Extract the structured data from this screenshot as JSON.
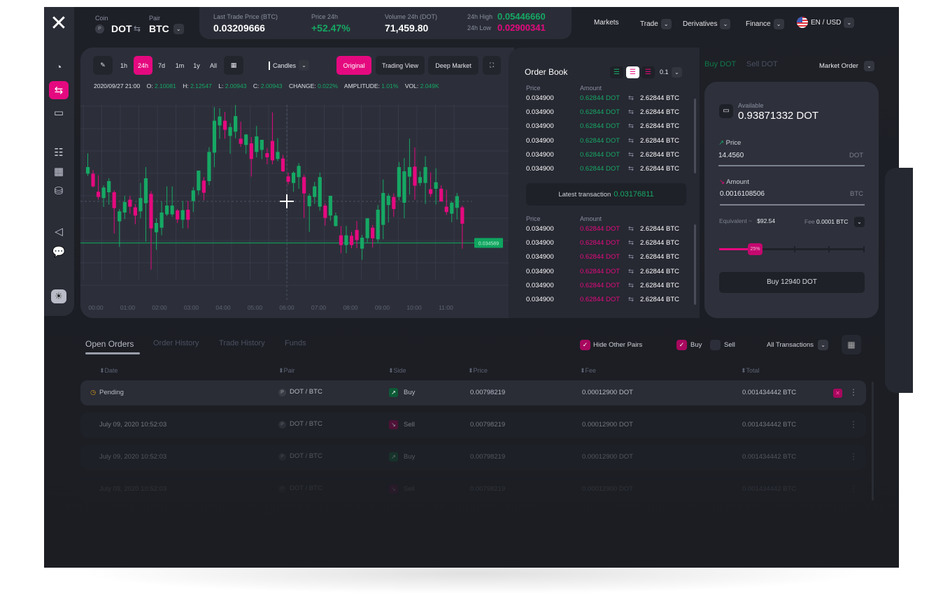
{
  "colors": {
    "accent": "#e5097f",
    "up": "#16a864",
    "down": "#e5097f",
    "background": "#1e2027",
    "panel": "#2c2f3a"
  },
  "sidebar": {
    "items": [
      {
        "icon": "pie-chart-icon"
      },
      {
        "icon": "exchange-icon",
        "active": true
      },
      {
        "icon": "wallet-icon"
      },
      {
        "icon": "list-icon"
      },
      {
        "icon": "calendar-icon"
      },
      {
        "icon": "coins-icon"
      },
      {
        "icon": "megaphone-icon"
      },
      {
        "icon": "chat-icon"
      },
      {
        "icon": "sun-icon"
      }
    ]
  },
  "header": {
    "coin_label": "Coin",
    "coin": "DOT",
    "pair_label": "Pair",
    "pair": "BTC",
    "stats": {
      "last_trade_label": "Last Trade Price (BTC)",
      "last_trade": "0.03209666",
      "price24_label": "Price 24h",
      "price24": "+52.47%",
      "volume_label": "Volume 24h (DOT)",
      "volume": "71,459.80",
      "high_label": "24h High",
      "high": "0.05446660",
      "low_label": "24h Low",
      "low": "0.02900341"
    },
    "nav": {
      "markets": "Markets",
      "trade": "Trade",
      "derivatives": "Derivatives",
      "finance": "Finance",
      "lang": "EN / USD"
    }
  },
  "chart_toolbar": {
    "periods": [
      "1h",
      "24h",
      "7d",
      "1m",
      "1y",
      "All"
    ],
    "active_period": "24h",
    "type": "Candles",
    "views": [
      "Original",
      "Trading View",
      "Deep Market"
    ],
    "active_view": "Original"
  },
  "ohlc": {
    "date": "2020/09/27 21:00",
    "o_label": "O:",
    "o": "2.10081",
    "h_label": "H:",
    "h": "2.12547",
    "l_label": "L:",
    "l": "2.00943",
    "c_label": "C:",
    "c": "2.00943",
    "change_label": "CHANGE:",
    "change": "0.022%",
    "amp_label": "AMPLITUDE:",
    "amp": "1.01%",
    "vol_label": "VOL:",
    "vol": "2.049K"
  },
  "chart_data": {
    "type": "candlestick",
    "x_ticks": [
      "00:00",
      "01:00",
      "02:00",
      "03:00",
      "04:00",
      "05:00",
      "06:00",
      "07:00",
      "08:00",
      "09:00",
      "10:00",
      "11:00"
    ],
    "ylim": [
      0.034,
      0.036
    ],
    "grid": true,
    "price_marker": "0.034589",
    "candles": [
      [
        0.035297,
        0.035505,
        0.035274,
        0.035364
      ],
      [
        0.035297,
        0.035333,
        0.035155,
        0.035167
      ],
      [
        0.035112,
        0.035281,
        0.035031,
        0.035059
      ],
      [
        0.035048,
        0.035178,
        0.034957,
        0.035155
      ],
      [
        0.035107,
        0.03525,
        0.034981,
        0.035221
      ],
      [
        0.035107,
        0.035126,
        0.034686,
        0.034945
      ],
      [
        0.03481,
        0.034936,
        0.034548,
        0.034912
      ],
      [
        0.0349,
        0.035071,
        0.034833,
        0.035007
      ],
      [
        0.035031,
        0.035071,
        0.034888,
        0.03496
      ],
      [
        0.034953,
        0.034988,
        0.034781,
        0.034869
      ],
      [
        0.034912,
        0.035202,
        0.034841,
        0.035048
      ],
      [
        0.034995,
        0.035364,
        0.034603,
        0.03525
      ],
      [
        0.03509,
        0.035119,
        0.034317,
        0.034738
      ],
      [
        0.034698,
        0.034841,
        0.034519,
        0.034793
      ],
      [
        0.034745,
        0.035012,
        0.034667,
        0.0349
      ],
      [
        0.034881,
        0.035167,
        0.034864,
        0.034971
      ],
      [
        0.034881,
        0.035167,
        0.034857,
        0.034971
      ],
      [
        0.034921,
        0.034936,
        0.034793,
        0.034829
      ],
      [
        0.034826,
        0.035019,
        0.034738,
        0.034924
      ],
      [
        0.034929,
        0.035019,
        0.034738,
        0.034826
      ],
      [
        0.035017,
        0.035159,
        0.034905,
        0.035126
      ],
      [
        0.035126,
        0.035328,
        0.035079,
        0.035328
      ],
      [
        0.035226,
        0.035262,
        0.035024,
        0.035102
      ],
      [
        0.035221,
        0.035566,
        0.035178,
        0.035519
      ],
      [
        0.035512,
        0.035976,
        0.035362,
        0.035838
      ],
      [
        0.03579,
        0.035964,
        0.035654,
        0.035881
      ],
      [
        0.035838,
        0.035928,
        0.035654,
        0.035745
      ],
      [
        0.035683,
        0.035814,
        0.0355,
        0.035773
      ],
      [
        0.035726,
        0.035999,
        0.035659,
        0.035885
      ],
      [
        0.035654,
        0.035828,
        0.035571,
        0.035602
      ],
      [
        0.03559,
        0.035702,
        0.0355,
        0.035697
      ],
      [
        0.035607,
        0.035671,
        0.035267,
        0.035447
      ],
      [
        0.035519,
        0.035785,
        0.035464,
        0.035678
      ],
      [
        0.03554,
        0.035643,
        0.035447,
        0.035643
      ],
      [
        0.035507,
        0.035559,
        0.035393,
        0.035464
      ],
      [
        0.035631,
        0.035923,
        0.035393,
        0.035433
      ],
      [
        0.035447,
        0.035659,
        0.035424,
        0.035519
      ],
      [
        0.035452,
        0.035488,
        0.035314,
        0.035321
      ],
      [
        0.035269,
        0.035309,
        0.035186,
        0.035214
      ],
      [
        0.035202,
        0.035321,
        0.035112,
        0.035307
      ],
      [
        0.035262,
        0.035405,
        0.035143,
        0.035376
      ],
      [
        0.035262,
        0.035286,
        0.034845,
        0.035095
      ],
      [
        0.034964,
        0.035095,
        0.034702,
        0.035071
      ],
      [
        0.035059,
        0.035214,
        0.034988,
        0.035167
      ],
      [
        0.03496,
        0.035309,
        0.034917,
        0.035262
      ],
      [
        0.034971,
        0.034995,
        0.034767,
        0.034845
      ],
      [
        0.034869,
        0.035071,
        0.034817,
        0.035071
      ],
      [
        0.034762,
        0.0349,
        0.034757,
        0.034869
      ],
      [
        0.034667,
        0.034762,
        0.034484,
        0.034567
      ],
      [
        0.034567,
        0.034762,
        0.034484,
        0.034667
      ],
      [
        0.034662,
        0.034702,
        0.034536,
        0.034567
      ],
      [
        0.034722,
        0.034814,
        0.034536,
        0.034619
      ],
      [
        0.034531,
        0.034672,
        0.034417,
        0.034643
      ],
      [
        0.034638,
        0.034841,
        0.034591,
        0.034841
      ],
      [
        0.034745,
        0.034774,
        0.034543,
        0.034636
      ],
      [
        0.034626,
        0.034976,
        0.034595,
        0.034929
      ],
      [
        0.034774,
        0.035238,
        0.034626,
        0.0351
      ],
      [
        0.034976,
        0.035095,
        0.034798,
        0.035071
      ],
      [
        0.035059,
        0.035095,
        0.034857,
        0.034936
      ],
      [
        0.035059,
        0.035416,
        0.035024,
        0.035364
      ],
      [
        0.035,
        0.035457,
        0.034841,
        0.035321
      ],
      [
        0.035267,
        0.035654,
        0.035083,
        0.035364
      ],
      [
        0.035369,
        0.035564,
        0.035031,
        0.035174
      ],
      [
        0.035202,
        0.035321,
        0.035174,
        0.035262
      ],
      [
        0.035202,
        0.035476,
        0.034988,
        0.035364
      ],
      [
        0.035138,
        0.035309,
        0.035059,
        0.03509
      ],
      [
        0.035143,
        0.035352,
        0.034983,
        0.035209
      ],
      [
        0.035143,
        0.035178,
        0.035012,
        0.035012
      ],
      [
        0.03496,
        0.035131,
        0.034876,
        0.034905
      ],
      [
        0.034888,
        0.035012,
        0.034802,
        0.035
      ],
      [
        0.034948,
        0.0351,
        0.034829,
        0.035067
      ],
      [
        0.034953,
        0.034971,
        0.034531,
        0.034786
      ]
    ]
  },
  "order_book": {
    "title": "Order Book",
    "precision": "0.1",
    "price_label": "Price",
    "amount_label": "Amount",
    "asks": [
      {
        "price": "0.034900",
        "dot": "0.62844 DOT",
        "btc": "2.62844 BTC"
      },
      {
        "price": "0.034900",
        "dot": "0.62844 DOT",
        "btc": "2.62844 BTC"
      },
      {
        "price": "0.034900",
        "dot": "0.62844 DOT",
        "btc": "2.62844 BTC"
      },
      {
        "price": "0.034900",
        "dot": "0.62844 DOT",
        "btc": "2.62844 BTC"
      },
      {
        "price": "0.034900",
        "dot": "0.62844 DOT",
        "btc": "2.62844 BTC"
      },
      {
        "price": "0.034900",
        "dot": "0.62844 DOT",
        "btc": "2.62844 BTC"
      }
    ],
    "latest_label": "Latest transaction",
    "latest": "0.03176811",
    "bids": [
      {
        "price": "0.034900",
        "dot": "0.62844 DOT",
        "btc": "2.62844 BTC"
      },
      {
        "price": "0.034900",
        "dot": "0.62844 DOT",
        "btc": "2.62844 BTC"
      },
      {
        "price": "0.034900",
        "dot": "0.62844 DOT",
        "btc": "2.62844 BTC"
      },
      {
        "price": "0.034900",
        "dot": "0.62844 DOT",
        "btc": "2.62844 BTC"
      },
      {
        "price": "0.034900",
        "dot": "0.62844 DOT",
        "btc": "2.62844 BTC"
      },
      {
        "price": "0.034900",
        "dot": "0.62844 DOT",
        "btc": "2.62844 BTC"
      }
    ]
  },
  "trade": {
    "buy_tab": "Buy DOT",
    "sell_tab": "Sell DOT",
    "order_type": "Market Order",
    "available_label": "Available",
    "available": "0.93871332 DOT",
    "price_label": "Price",
    "price": "14.4560",
    "price_unit": "DOT",
    "amount_label": "Amount",
    "amount": "0.0016108506",
    "amount_unit": "BTC",
    "equiv_label": "Equivalent ~",
    "equiv": "$92.54",
    "fee_label": "Fee",
    "fee": "0.0001 BTC",
    "slider_percent": 25,
    "slider_label": "25%",
    "submit": "Buy 12940 DOT"
  },
  "orders": {
    "tabs": [
      "Open Orders",
      "Order History",
      "Trade History",
      "Funds"
    ],
    "active_tab": "Open Orders",
    "hide_other_pairs": "Hide Other Pairs",
    "hide_checked": true,
    "buy_label": "Buy",
    "buy_checked": true,
    "sell_label": "Sell",
    "sell_checked": false,
    "filter": "All Transactions",
    "columns": [
      "Date",
      "Pair",
      "Side",
      "Price",
      "Fee",
      "Total"
    ],
    "rows": [
      {
        "date": "Pending",
        "pair": "DOT / BTC",
        "side": "Buy",
        "price": "0.00798219",
        "fee": "0.00012900 DOT",
        "total": "0.001434442 BTC"
      },
      {
        "date": "July 09, 2020 10:52:03",
        "pair": "DOT / BTC",
        "side": "Sell",
        "price": "0.00798219",
        "fee": "0.00012900 DOT",
        "total": "0.001434442 BTC"
      },
      {
        "date": "July 09, 2020 10:52:03",
        "pair": "DOT / BTC",
        "side": "Buy",
        "price": "0.00798219",
        "fee": "0.00012900 DOT",
        "total": "0.001434442 BTC"
      },
      {
        "date": "July 09, 2020 10:52:03",
        "pair": "DOT / BTC",
        "side": "Sell",
        "price": "0.00798219",
        "fee": "0.00012900 DOT",
        "total": "0.001434442 BTC"
      }
    ]
  }
}
